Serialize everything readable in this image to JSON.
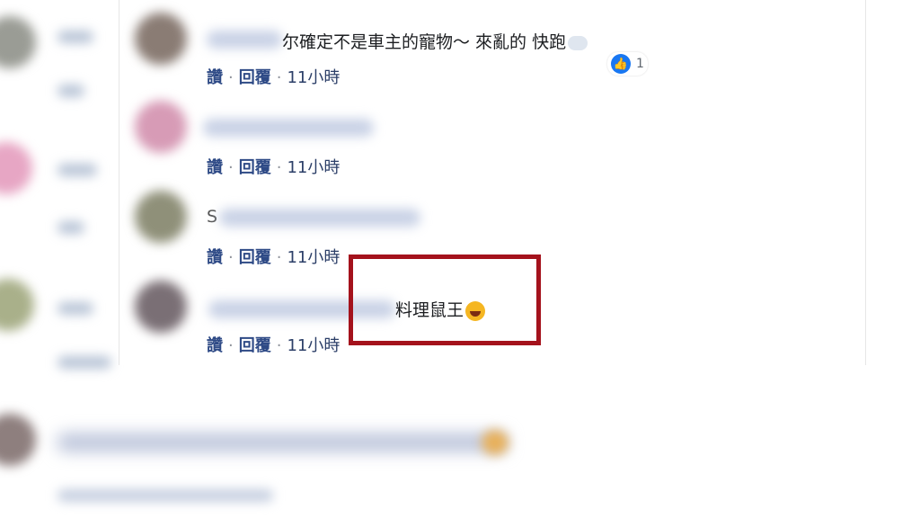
{
  "comments": [
    {
      "text": "尔確定不是車主的寵物～ 來亂的 快跑",
      "actions": {
        "like": "讚",
        "reply": "回覆",
        "time": "11小時"
      },
      "reaction": {
        "icon": "thumbs-up-icon",
        "count": "1"
      }
    },
    {
      "text": "",
      "actions": {
        "like": "讚",
        "reply": "回覆",
        "time": "11小時"
      }
    },
    {
      "text": "S",
      "actions": {
        "like": "讚",
        "reply": "回覆",
        "time": "11小時"
      }
    },
    {
      "text": "料理鼠王",
      "actions": {
        "like": "讚",
        "reply": "回覆",
        "time": "11小時"
      }
    }
  ],
  "colors": {
    "highlight_border": "#a4121c",
    "link_blue": "#385898",
    "like_blue": "#1877f2"
  }
}
